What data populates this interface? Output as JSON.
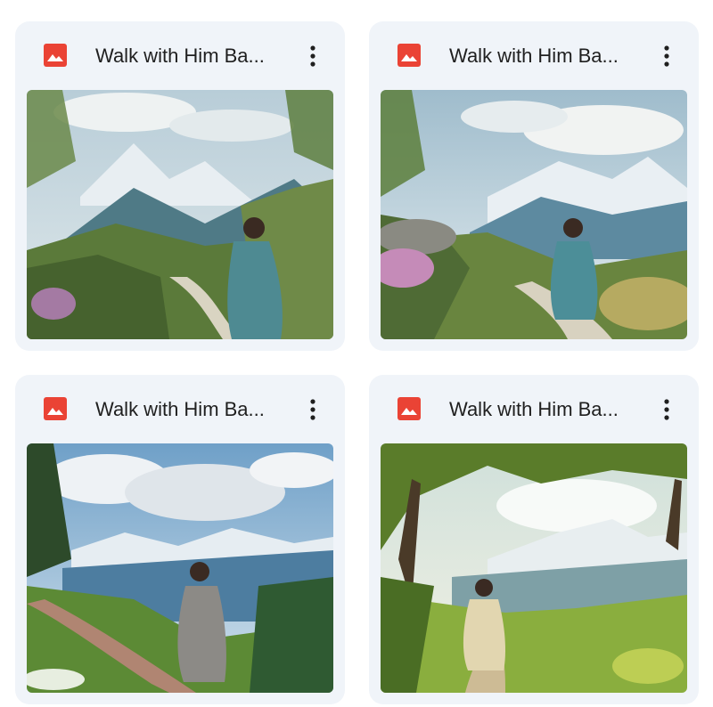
{
  "files": [
    {
      "title": "Walk with Him Ba...",
      "icon": "image-file-icon",
      "menu_icon": "more-vert-icon"
    },
    {
      "title": "Walk with Him Ba...",
      "icon": "image-file-icon",
      "menu_icon": "more-vert-icon"
    },
    {
      "title": "Walk with Him Ba...",
      "icon": "image-file-icon",
      "menu_icon": "more-vert-icon"
    },
    {
      "title": "Walk with Him Ba...",
      "icon": "image-file-icon",
      "menu_icon": "more-vert-icon"
    }
  ],
  "colors": {
    "card_bg": "#f0f4f9",
    "icon_red": "#ea4335",
    "title_text": "#1f1f1f"
  }
}
